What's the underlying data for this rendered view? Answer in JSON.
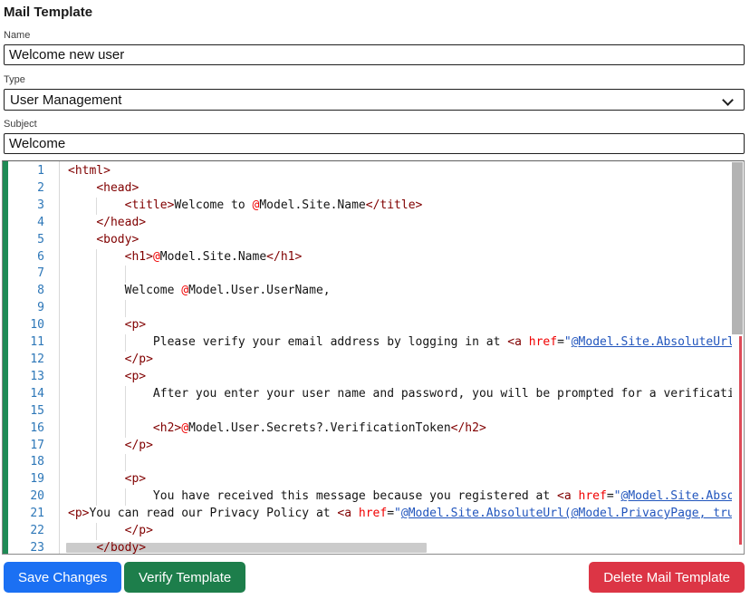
{
  "page": {
    "title": "Mail Template"
  },
  "form": {
    "name": {
      "label": "Name",
      "value": "Welcome new user"
    },
    "type": {
      "label": "Type",
      "value": "User Management"
    },
    "subject": {
      "label": "Subject",
      "value": "Welcome"
    }
  },
  "buttons": {
    "save": "Save Changes",
    "verify": "Verify Template",
    "delete": "Delete Mail Template"
  },
  "colors": {
    "save_button": "#1b70f3",
    "verify_button": "#1d7e4b",
    "delete_button": "#dc3545",
    "gutter_change_bar": "#1f8a55",
    "line_number": "#2d77b8",
    "syntax_tag": "#800000",
    "syntax_attribute": "#f00000",
    "syntax_razor_at": "#f00000",
    "syntax_string": "#2155bd",
    "scrollbar_error_mark": "#dd4a57"
  },
  "editor": {
    "lines": [
      {
        "n": 1,
        "ind": 0,
        "tokens": [
          [
            "tag",
            "<html>"
          ]
        ]
      },
      {
        "n": 2,
        "ind": 4,
        "tokens": [
          [
            "tag",
            "<head>"
          ]
        ]
      },
      {
        "n": 3,
        "ind": 8,
        "tokens": [
          [
            "tag",
            "<title>"
          ],
          [
            "txt",
            "Welcome to "
          ],
          [
            "at",
            "@"
          ],
          [
            "txt",
            "Model.Site.Name"
          ],
          [
            "tag",
            "</title>"
          ]
        ]
      },
      {
        "n": 4,
        "ind": 4,
        "tokens": [
          [
            "tag",
            "</head>"
          ]
        ]
      },
      {
        "n": 5,
        "ind": 4,
        "tokens": [
          [
            "tag",
            "<body>"
          ]
        ]
      },
      {
        "n": 6,
        "ind": 8,
        "tokens": [
          [
            "tag",
            "<h1>"
          ],
          [
            "at",
            "@"
          ],
          [
            "txt",
            "Model.Site.Name"
          ],
          [
            "tag",
            "</h1>"
          ]
        ]
      },
      {
        "n": 7,
        "ind": 12,
        "tokens": []
      },
      {
        "n": 8,
        "ind": 8,
        "tokens": [
          [
            "txt",
            "Welcome "
          ],
          [
            "at",
            "@"
          ],
          [
            "txt",
            "Model.User.UserName,"
          ]
        ]
      },
      {
        "n": 9,
        "ind": 12,
        "tokens": []
      },
      {
        "n": 10,
        "ind": 8,
        "tokens": [
          [
            "tag",
            "<p>"
          ]
        ]
      },
      {
        "n": 11,
        "ind": 12,
        "tokens": [
          [
            "txt",
            "Please verify your email address by logging in at "
          ],
          [
            "tag",
            "<a "
          ],
          [
            "attr",
            "href"
          ],
          [
            "txt",
            "="
          ],
          [
            "q",
            "\""
          ],
          [
            "str",
            "@Model.Site.AbsoluteUrl(@Mo"
          ]
        ]
      },
      {
        "n": 12,
        "ind": 8,
        "tokens": [
          [
            "tag",
            "</p>"
          ]
        ]
      },
      {
        "n": 13,
        "ind": 8,
        "tokens": [
          [
            "tag",
            "<p>"
          ]
        ]
      },
      {
        "n": 14,
        "ind": 12,
        "tokens": [
          [
            "txt",
            "After you enter your user name and password, you will be prompted for a verification c"
          ]
        ]
      },
      {
        "n": 15,
        "ind": 12,
        "tokens": []
      },
      {
        "n": 16,
        "ind": 12,
        "tokens": [
          [
            "tag",
            "<h2>"
          ],
          [
            "at",
            "@"
          ],
          [
            "txt",
            "Model.User.Secrets?.VerificationToken"
          ],
          [
            "tag",
            "</h2>"
          ]
        ]
      },
      {
        "n": 17,
        "ind": 8,
        "tokens": [
          [
            "tag",
            "</p>"
          ]
        ]
      },
      {
        "n": 18,
        "ind": 12,
        "tokens": []
      },
      {
        "n": 19,
        "ind": 8,
        "tokens": [
          [
            "tag",
            "<p>"
          ]
        ]
      },
      {
        "n": 20,
        "ind": 12,
        "tokens": [
          [
            "txt",
            "You have received this message because you registered at "
          ],
          [
            "tag",
            "<a "
          ],
          [
            "attr",
            "href"
          ],
          [
            "txt",
            "="
          ],
          [
            "q",
            "\""
          ],
          [
            "str",
            "@Model.Site.Absolute"
          ]
        ]
      },
      {
        "n": 21,
        "ind": 0,
        "tokens": [
          [
            "tag",
            "<p>"
          ],
          [
            "txt",
            "You can read our Privacy Policy at "
          ],
          [
            "tag",
            "<a "
          ],
          [
            "attr",
            "href"
          ],
          [
            "txt",
            "="
          ],
          [
            "q",
            "\""
          ],
          [
            "str",
            "@Model.Site.AbsoluteUrl(@Model.PrivacyPage, true)"
          ],
          [
            "q",
            "\""
          ],
          [
            "tag",
            ">"
          ]
        ]
      },
      {
        "n": 22,
        "ind": 8,
        "tokens": [
          [
            "tag",
            "</p>"
          ]
        ]
      },
      {
        "n": 23,
        "ind": 4,
        "tokens": [
          [
            "tag",
            "</body>"
          ]
        ]
      }
    ]
  }
}
